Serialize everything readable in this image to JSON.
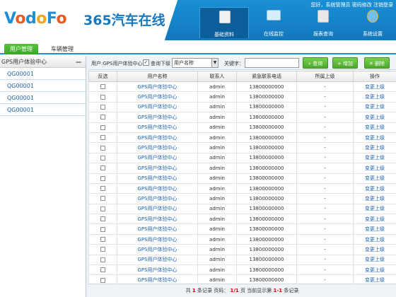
{
  "header": {
    "brand": {
      "v": "V",
      "o1": "o",
      "d": "d",
      "o2": "o",
      "f": "F",
      "o3": "o"
    },
    "title": "365汽车在线",
    "links": "您好，系统管理员  密码修改  注销登录",
    "nav": [
      {
        "label": "基础资料",
        "icon": "archive-icon",
        "color": "#f1f1f1"
      },
      {
        "label": "在线监控",
        "icon": "monitor-icon",
        "color": "#d7eef9"
      },
      {
        "label": "报表查询",
        "icon": "report-icon",
        "color": "#e8e8e8"
      },
      {
        "label": "系统设置",
        "icon": "settings-globe-icon",
        "color": "#73c1ea"
      }
    ]
  },
  "tabs": {
    "user_mgmt": "用户管理",
    "vehicle_mgmt": "车辆管理"
  },
  "sidebar": {
    "head": "GPS用户体验中心",
    "collapse": "—",
    "items": [
      "QG00001",
      "QG00001",
      "QG00001",
      "QG00001"
    ]
  },
  "toolbar": {
    "path": "用户:GPS用户体验中心",
    "checkbox_checked": "✓",
    "checkbox_label": "查询下级",
    "select_value": "用户名称",
    "keyword_label": "关键字：",
    "search": "查询",
    "add": "增加",
    "delete": "删除"
  },
  "table": {
    "columns": [
      "反选",
      "用户名称",
      "联系人",
      "紧急联系电话",
      "所属上级",
      "操作"
    ],
    "rows": [
      {
        "name": "GPS用户体验中心",
        "contact": "admin",
        "phone": "13800000000",
        "parent": "-",
        "op": "变更上级"
      },
      {
        "name": "GPS用户体验中心",
        "contact": "admin",
        "phone": "13800000000",
        "parent": "-",
        "op": "变更上级"
      },
      {
        "name": "GPS用户体验中心",
        "contact": "admin",
        "phone": "13800000000",
        "parent": "-",
        "op": "变更上级"
      },
      {
        "name": "GPS用户体验中心",
        "contact": "admin",
        "phone": "13800000000",
        "parent": "-",
        "op": "变更上级"
      },
      {
        "name": "GPS用户体验中心",
        "contact": "admin",
        "phone": "13800000000",
        "parent": "-",
        "op": "变更上级"
      },
      {
        "name": "GPS用户体验中心",
        "contact": "admin",
        "phone": "13800000000",
        "parent": "-",
        "op": "变更上级"
      },
      {
        "name": "GPS用户体验中心",
        "contact": "admin",
        "phone": "13800000000",
        "parent": "-",
        "op": "变更上级"
      },
      {
        "name": "GPS用户体验中心",
        "contact": "admin",
        "phone": "13800000000",
        "parent": "-",
        "op": "变更上级"
      },
      {
        "name": "GPS用户体验中心",
        "contact": "admin",
        "phone": "13800000000",
        "parent": "-",
        "op": "变更上级"
      },
      {
        "name": "GPS用户体验中心",
        "contact": "admin",
        "phone": "13800000000",
        "parent": "-",
        "op": "变更上级"
      },
      {
        "name": "GPS用户体验中心",
        "contact": "admin",
        "phone": "13800000000",
        "parent": "-",
        "op": "变更上级"
      },
      {
        "name": "GPS用户体验中心",
        "contact": "admin",
        "phone": "13800000000",
        "parent": "-",
        "op": "变更上级"
      },
      {
        "name": "GPS用户体验中心",
        "contact": "admin",
        "phone": "13800000000",
        "parent": "-",
        "op": "变更上级"
      },
      {
        "name": "GPS用户体验中心",
        "contact": "admin",
        "phone": "13800000000",
        "parent": "-",
        "op": "变更上级"
      },
      {
        "name": "GPS用户体验中心",
        "contact": "admin",
        "phone": "13800000000",
        "parent": "-",
        "op": "变更上级"
      },
      {
        "name": "GPS用户体验中心",
        "contact": "admin",
        "phone": "13800000000",
        "parent": "-",
        "op": "变更上级"
      },
      {
        "name": "GPS用户体验中心",
        "contact": "admin",
        "phone": "13800000000",
        "parent": "-",
        "op": "变更上级"
      },
      {
        "name": "GPS用户体验中心",
        "contact": "admin",
        "phone": "13800000000",
        "parent": "-",
        "op": "变更上级"
      },
      {
        "name": "GPS用户体验中心",
        "contact": "admin",
        "phone": "13800000000",
        "parent": "-",
        "op": "变更上级"
      },
      {
        "name": "GPS用户体验中心",
        "contact": "admin",
        "phone": "13800000000",
        "parent": "-",
        "op": "变更上级"
      }
    ]
  },
  "footer": {
    "p1": "共",
    "total": "1",
    "p2": "条记录 页码：",
    "page": "1/1",
    "p3": "页 当前显示第",
    "range": "1-1",
    "p4": "条记录"
  },
  "colors": {
    "header_blue": "#1a8fd4",
    "active_green": "#3aa727",
    "link_blue": "#1d63b4"
  }
}
